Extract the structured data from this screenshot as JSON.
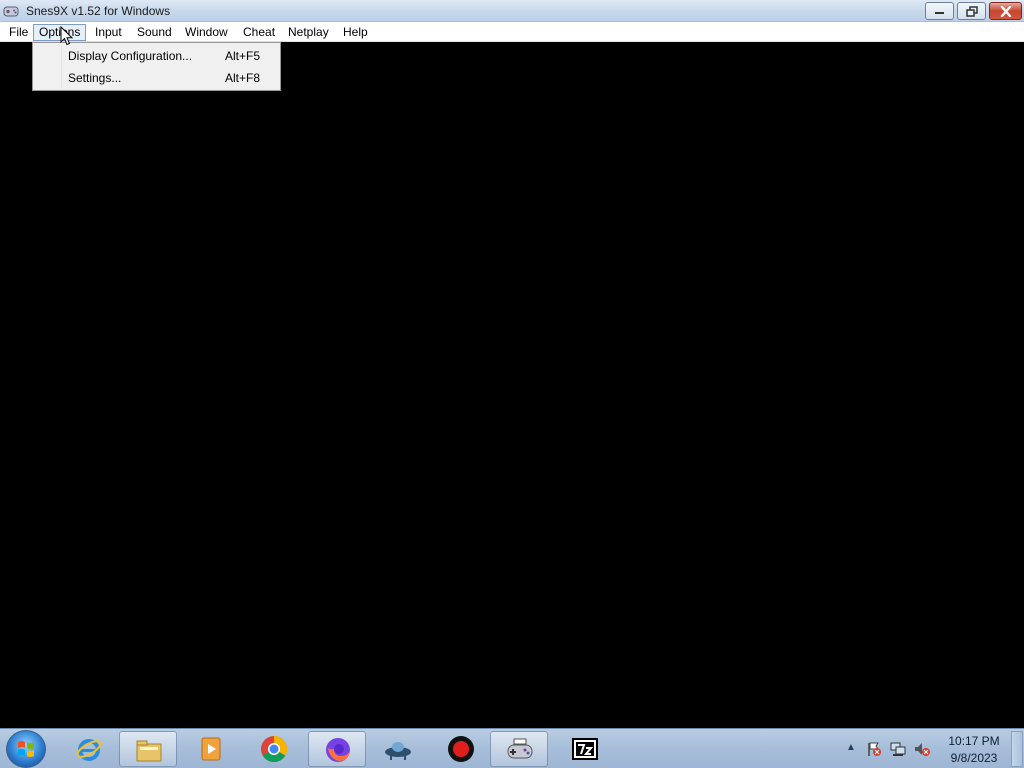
{
  "window": {
    "title": "Snes9X v1.52 for Windows",
    "icons": {
      "app": "snes9x-icon",
      "minimize": "minimize-icon",
      "maximize": "maximize-icon",
      "close": "close-icon"
    }
  },
  "menubar": {
    "items": [
      "File",
      "Options",
      "Input",
      "Sound",
      "Window",
      "Cheat",
      "Netplay",
      "Help"
    ],
    "open_item": "Options"
  },
  "options_menu": {
    "items": [
      {
        "label": "Display Configuration...",
        "shortcut": "Alt+F5"
      },
      {
        "label": "Settings...",
        "shortcut": "Alt+F8"
      }
    ]
  },
  "taskbar": {
    "start_icon": "windows-start-icon",
    "pinned": [
      {
        "name": "internet-explorer-icon",
        "active": false
      },
      {
        "name": "file-explorer-icon",
        "active": true
      },
      {
        "name": "media-player-icon",
        "active": false
      },
      {
        "name": "chrome-icon",
        "active": false
      },
      {
        "name": "firefox-icon",
        "active": true
      },
      {
        "name": "ufo-app-icon",
        "active": false
      },
      {
        "name": "record-icon",
        "active": false
      },
      {
        "name": "snes9x-controller-icon",
        "active": true
      },
      {
        "name": "7zip-icon",
        "active": false
      }
    ]
  },
  "tray": {
    "icons": [
      "action-center-flag-icon",
      "network-icon",
      "volume-muted-icon"
    ],
    "time": "10:17 PM",
    "date": "9/8/2023"
  },
  "colors": {
    "desktop": "#000000",
    "menu_highlight": "#e6eef8",
    "close_red": "#c7462f"
  }
}
